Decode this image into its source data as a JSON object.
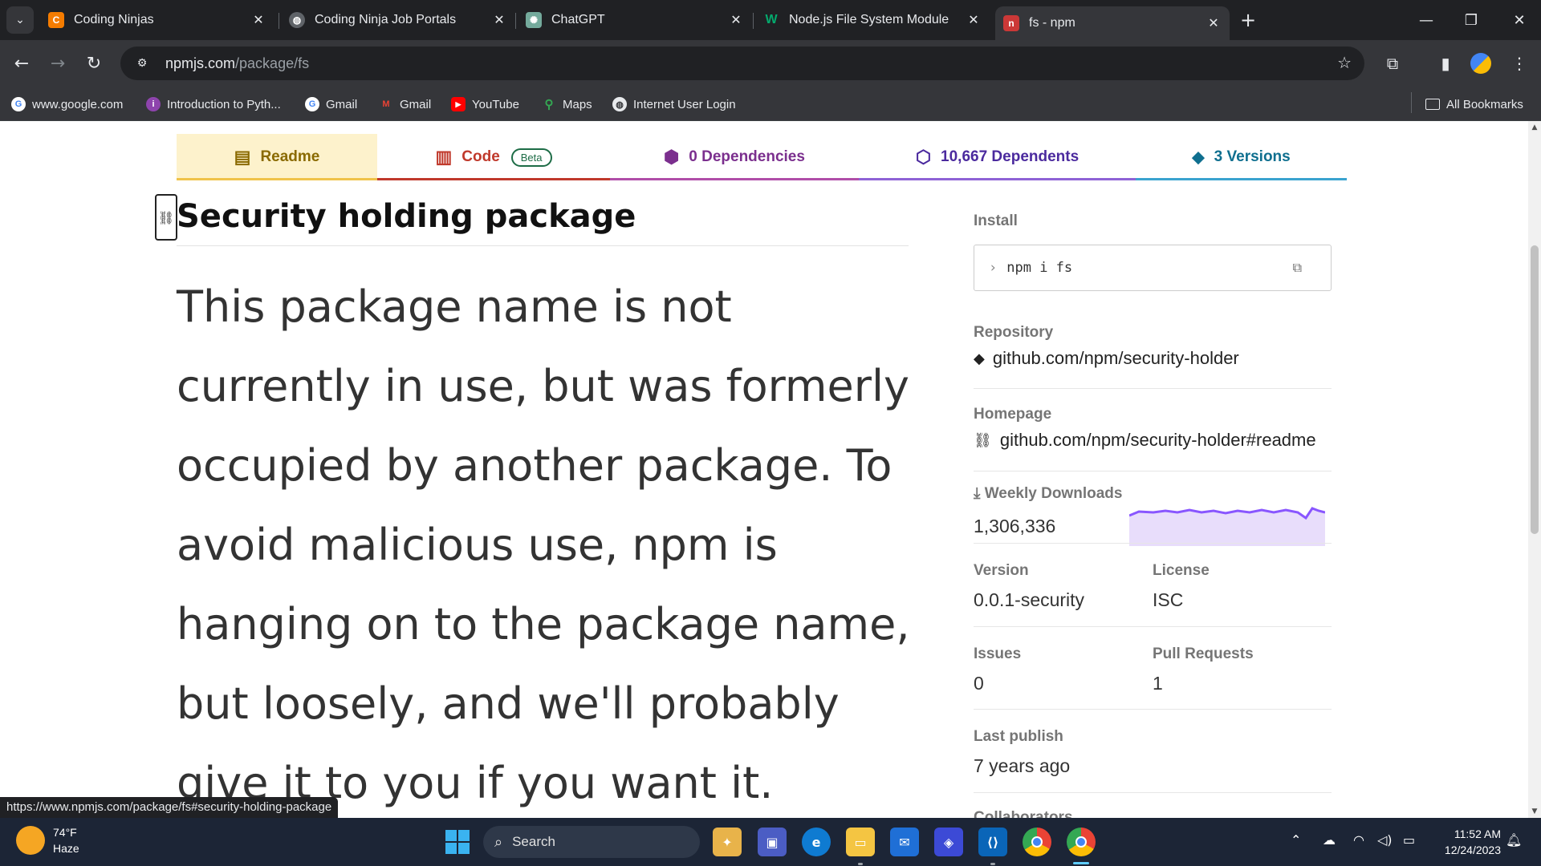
{
  "browser": {
    "tabs": [
      {
        "label": "Coding Ninjas",
        "favicon": "coding-ninjas-icon",
        "color": "#f57c00"
      },
      {
        "label": "Coding Ninja Job Portals",
        "favicon": "globe-icon",
        "color": "#5f6368"
      },
      {
        "label": "ChatGPT",
        "favicon": "chatgpt-icon",
        "color": "#74aa9c"
      },
      {
        "label": "Node.js File System Module",
        "favicon": "w3schools-icon",
        "color": "#04aa6d"
      },
      {
        "label": "fs - npm",
        "favicon": "npm-icon",
        "color": "#cb3837"
      }
    ],
    "url_host": "npmjs.com",
    "url_path": "/package/fs",
    "bookmarks": [
      {
        "label": "www.google.com",
        "icon": "google-icon"
      },
      {
        "label": "Introduction to Pyth...",
        "icon": "python-course-icon"
      },
      {
        "label": "Gmail",
        "icon": "google-icon"
      },
      {
        "label": "Gmail",
        "icon": "gmail-icon"
      },
      {
        "label": "YouTube",
        "icon": "youtube-icon"
      },
      {
        "label": "Maps",
        "icon": "maps-icon"
      },
      {
        "label": "Internet User Login",
        "icon": "globe-icon"
      }
    ],
    "all_bookmarks": "All Bookmarks",
    "status_url": "https://www.npmjs.com/package/fs#security-holding-package"
  },
  "package_tabs": [
    {
      "label": "Readme",
      "icon": "readme-icon",
      "color": "#8a6a00"
    },
    {
      "label": "Code",
      "icon": "code-icon",
      "color": "#c0392b",
      "badge": "Beta"
    },
    {
      "label": "0 Dependencies",
      "icon": "dependencies-icon",
      "color": "#7b2f8e"
    },
    {
      "label": "10,667 Dependents",
      "icon": "dependents-icon",
      "color": "#4b2a9e"
    },
    {
      "label": "3 Versions",
      "icon": "versions-icon",
      "color": "#0f6f8f"
    }
  ],
  "readme": {
    "heading": "Security holding package",
    "body": "This package name is not currently in use, but was formerly occupied by another package. To avoid malicious use, npm is hanging on to the package name, but loosely, and we'll probably give it to you if you want it."
  },
  "sidebar": {
    "install_label": "Install",
    "install_cmd": "npm i fs",
    "repository_label": "Repository",
    "repository": "github.com/npm/security-holder",
    "homepage_label": "Homepage",
    "homepage": "github.com/npm/security-holder#readme",
    "weekly_downloads_label": "Weekly Downloads",
    "weekly_downloads": "1,306,336",
    "version_label": "Version",
    "version": "0.0.1-security",
    "license_label": "License",
    "license": "ISC",
    "issues_label": "Issues",
    "issues": "0",
    "pull_requests_label": "Pull Requests",
    "pull_requests": "1",
    "last_publish_label": "Last publish",
    "last_publish": "7 years ago",
    "collaborators_label": "Collaborators"
  },
  "taskbar": {
    "temperature": "74°F",
    "condition": "Haze",
    "search_label": "Search",
    "time": "11:52 AM",
    "date": "12/24/2023"
  }
}
